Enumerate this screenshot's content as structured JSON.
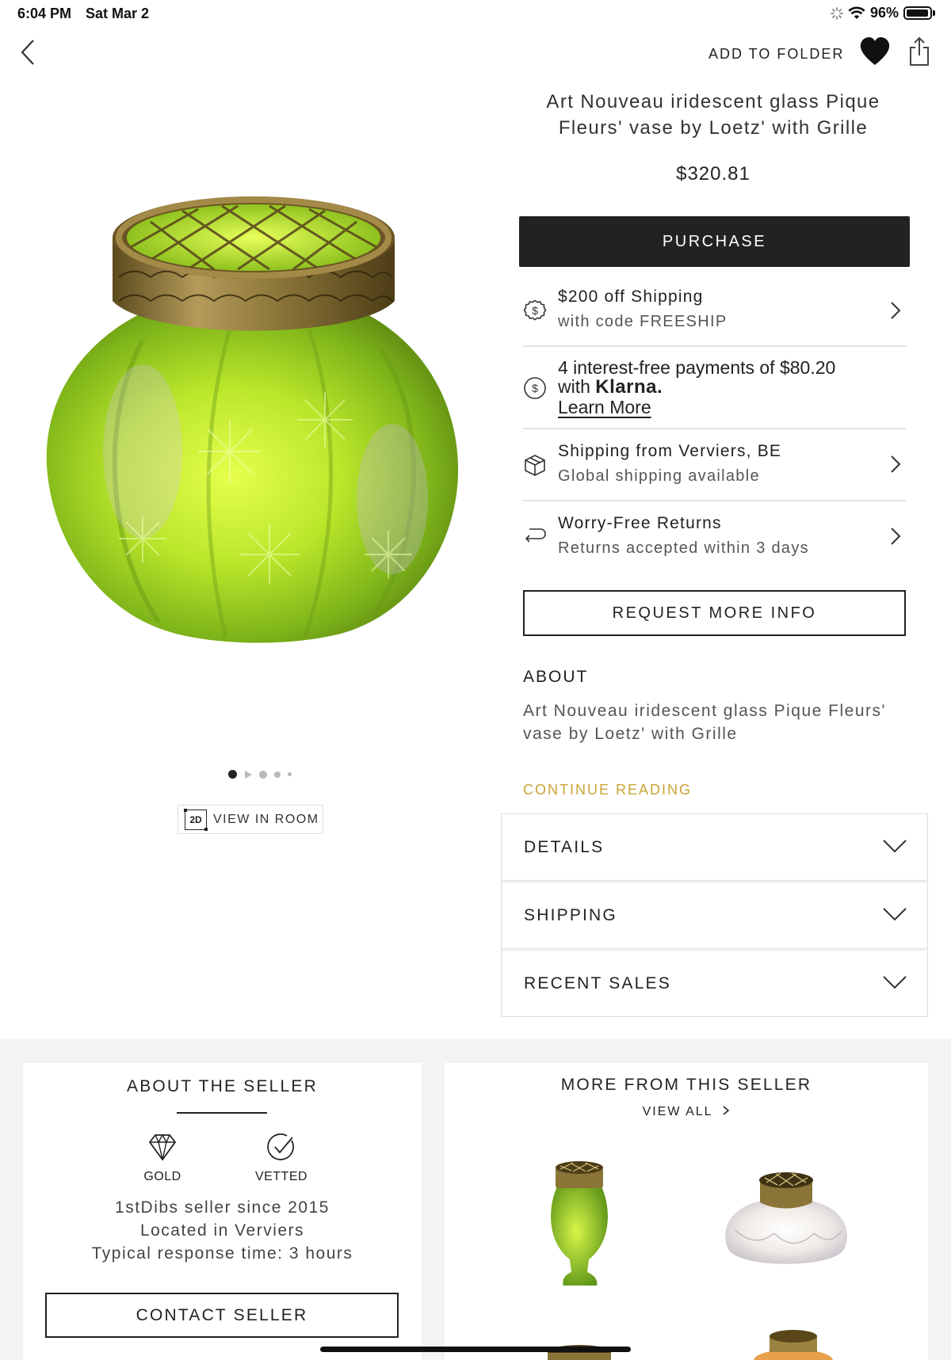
{
  "status_bar": {
    "time": "6:04 PM",
    "date": "Sat Mar 2",
    "battery": "96%",
    "battery_level": 0.96
  },
  "nav": {
    "add_to_folder": "ADD TO FOLDER"
  },
  "product": {
    "title": "Art Nouveau iridescent glass Pique Fleurs' vase by Loetz' with Grille",
    "price": "$320.81",
    "purchase_label": "PURCHASE",
    "image_count": 5,
    "image_index": 1,
    "view_in_room_label": "VIEW IN ROOM",
    "view_in_room_icon_text": "2D"
  },
  "info_rows": {
    "shipping_offer": {
      "line1": "$200 off Shipping",
      "line2": "with code FREESHIP",
      "icon": "dollar-coin-icon"
    },
    "klarna": {
      "line1": "4 interest-free payments of $80.20",
      "with": "with",
      "brand": "Klarna.",
      "learn_more": "Learn More",
      "icon": "dollar-coin-icon"
    },
    "shipping_from": {
      "line1": "Shipping from Verviers, BE",
      "line2": "Global shipping available",
      "icon": "box-icon"
    },
    "returns": {
      "line1": "Worry-Free Returns",
      "line2": "Returns accepted within 3 days",
      "icon": "return-arrow-icon"
    }
  },
  "request_more_info": "REQUEST MORE INFO",
  "about": {
    "heading": "ABOUT",
    "body": "Art Nouveau iridescent glass Pique Fleurs' vase by Loetz' with Grille",
    "continue_reading": "CONTINUE READING"
  },
  "accordions": {
    "details": "DETAILS",
    "shipping": "SHIPPING",
    "recent_sales": "RECENT SALES"
  },
  "seller": {
    "heading": "ABOUT THE SELLER",
    "badge_gold": "GOLD",
    "badge_vetted": "VETTED",
    "since": "1stDibs seller since 2015",
    "location": "Located in Verviers",
    "response_time": "Typical response time: 3 hours",
    "contact": "CONTACT SELLER"
  },
  "more_from_seller": {
    "heading": "MORE FROM THIS SELLER",
    "view_all": "VIEW ALL"
  },
  "colors": {
    "accent_gold": "#c9a436",
    "button_dark": "#222222",
    "band_gray": "#f3f3f3"
  }
}
